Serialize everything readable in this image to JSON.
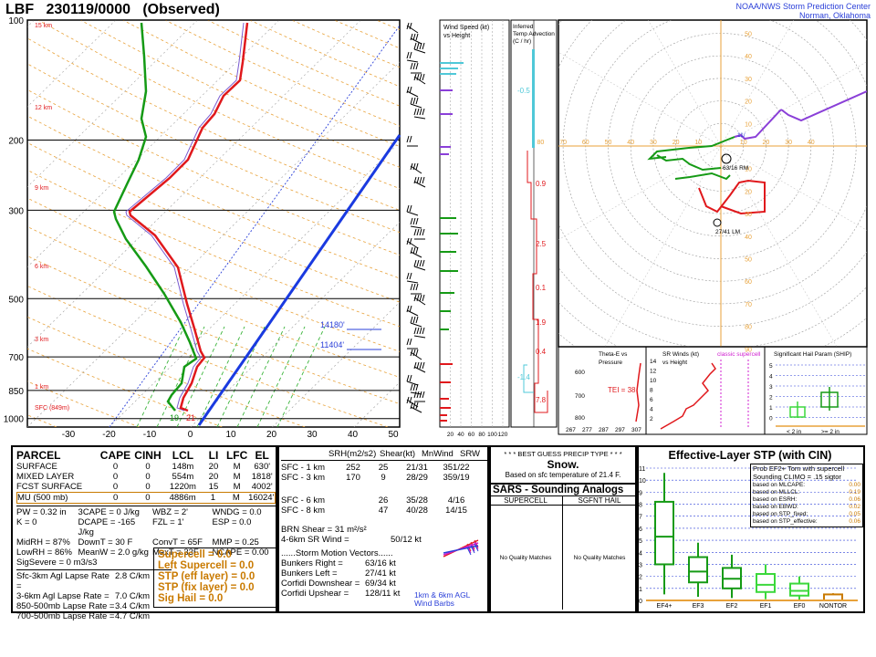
{
  "header": {
    "station": "LBF",
    "time": "230119/0000",
    "status": "(Observed)",
    "spc_line1": "NOAA/NWS Storm Prediction Center",
    "spc_line2": "Norman, Oklahoma"
  },
  "chart_data": [
    {
      "type": "line",
      "title": "Skew-T",
      "pressure_ticks": [
        "100",
        "200",
        "300",
        "500",
        "700",
        "850",
        "1000"
      ],
      "temp_ticks": [
        "-30",
        "-20",
        "-10",
        "0",
        "10",
        "20",
        "30",
        "40",
        "50"
      ],
      "height_labels": [
        "15 km",
        "12 km",
        "9 km",
        "6 km",
        "3 km",
        "1 km",
        "SFC (849m)"
      ],
      "level_labels": [
        "14180'",
        "11404'"
      ],
      "surface_labels": {
        "dew": "19",
        "temp": "21"
      },
      "series": [
        {
          "role": "temperature",
          "color": "#e0181c"
        },
        {
          "role": "dewpoint",
          "color": "#159a15"
        },
        {
          "role": "parcel",
          "color": "#1a3ae0"
        }
      ]
    },
    {
      "type": "line",
      "title": "Wind Speed (kt) vs Height",
      "x_ticks": [
        "20",
        "40",
        "60",
        "80",
        "100",
        "120"
      ]
    },
    {
      "type": "bar",
      "title": "Inferred Temp Advection (C / hr)",
      "values": [
        "-0.5",
        "0.9",
        "2.5",
        "0.1",
        "1.9",
        "0.4",
        "-1.4",
        "7.8"
      ]
    },
    {
      "type": "line",
      "title": "Hodograph",
      "x_ticks": [
        "80",
        "70",
        "60",
        "50",
        "40",
        "30",
        "20",
        "10",
        "10",
        "20",
        "30",
        "40"
      ],
      "y_ticks": [
        "50",
        "40",
        "30",
        "20",
        "10",
        "10",
        "20",
        "30",
        "40",
        "50",
        "60",
        "70",
        "80",
        "90"
      ],
      "labels": {
        "rm": "63/16 RM",
        "lm": "27/41 LM",
        "mean": "11/"
      }
    },
    {
      "type": "line",
      "title": "Theta-E vs Pressure",
      "x_ticks": [
        "267",
        "277",
        "287",
        "297",
        "307"
      ],
      "y_ticks": [
        "600",
        "700",
        "800",
        "900"
      ],
      "tei": "TEI = 38"
    },
    {
      "type": "line",
      "title": "SR Winds (kt) vs Height",
      "y_ticks": [
        "14",
        "12",
        "10",
        "8",
        "6",
        "4",
        "2"
      ],
      "extra": "classic supercell"
    },
    {
      "type": "bar",
      "title": "Significant Hail Param (SHIP)",
      "y_ticks": [
        "5",
        "4",
        "3",
        "2",
        "1",
        "0"
      ],
      "categories": [
        "< 2 in",
        ">= 2 in"
      ]
    },
    {
      "type": "bar",
      "title": "Effective-Layer STP (with CIN)",
      "categories": [
        "EF4+",
        "EF3",
        "EF2",
        "EF1",
        "EF0",
        "NONTOR"
      ],
      "y_ticks": [
        "11",
        "10",
        "9",
        "8",
        "7",
        "6",
        "5",
        "4",
        "3",
        "2",
        "1",
        "0"
      ],
      "medians": [
        5.3,
        2.4,
        1.8,
        1.3,
        0.8,
        0
      ]
    }
  ],
  "parcel_table": {
    "headers": [
      "PARCEL",
      "CAPE",
      "CINH",
      "LCL",
      "LI",
      "LFC",
      "EL"
    ],
    "rows": [
      [
        "SURFACE",
        "0",
        "0",
        "148m",
        "20",
        "M",
        "630'"
      ],
      [
        "MIXED LAYER",
        "0",
        "0",
        "554m",
        "20",
        "M",
        "1818'"
      ],
      [
        "FCST SURFACE",
        "0",
        "0",
        "1220m",
        "15",
        "M",
        "4002'"
      ],
      [
        "MU    (500 mb)",
        "0",
        "0",
        "4886m",
        "1",
        "M",
        "16024'"
      ]
    ],
    "stats": [
      [
        "PW = 0.32 in",
        "3CAPE = 0 J/kg",
        "WBZ = 2'",
        "WNDG = 0.0"
      ],
      [
        "K = 0",
        "DCAPE = -165 J/kg",
        "FZL = 1'",
        "ESP = 0.0"
      ],
      [
        "MidRH = 87%",
        "DownT = 30 F",
        "ConvT = 65F",
        "MMP = 0.25"
      ],
      [
        "LowRH = 86%",
        "MeanW = 2.0 g/kg",
        "MaxT = 33F",
        "NCAPE = 0.00"
      ]
    ],
    "sigsevere": "SigSevere = 0 m3/s3",
    "lapse": [
      [
        "Sfc-3km Agl Lapse Rate =",
        "2.8 C/km"
      ],
      [
        "3-6km Agl Lapse Rate =",
        "7.0 C/km"
      ],
      [
        "850-500mb Lapse Rate =",
        "3.4 C/km"
      ],
      [
        "700-500mb Lapse Rate =",
        "4.7 C/km"
      ]
    ],
    "indices": [
      "Supercell = 0.0",
      "Left Supercell = 0.0",
      "STP (eff layer) = 0.0",
      "STP (fix layer) = 0.0",
      "Sig Hail = 0.0"
    ]
  },
  "kinematics": {
    "headers": [
      "SRH(m2/s2)",
      "Shear(kt)",
      "MnWind",
      "SRW"
    ],
    "rows": [
      [
        "SFC - 1 km",
        "252",
        "25",
        "21/31",
        "351/22"
      ],
      [
        "SFC - 3 km",
        "170",
        "9",
        "28/29",
        "359/19"
      ],
      [
        "SFC - 6 km",
        "",
        "26",
        "35/28",
        "4/16"
      ],
      [
        "SFC - 8 km",
        "",
        "47",
        "40/28",
        "14/15"
      ]
    ],
    "brn_shear": "BRN Shear =  31 m²/s²",
    "sr_wind": "4-6km SR Wind =",
    "sr_wind_val": "50/12 kt",
    "motion_title": "......Storm Motion Vectors......",
    "motion": [
      [
        "Bunkers Right =",
        "63/16 kt"
      ],
      [
        "Bunkers Left =",
        "27/41 kt"
      ],
      [
        "Corfidi Downshear =",
        "69/34 kt"
      ],
      [
        "Corfidi Upshear =",
        "128/11 kt"
      ]
    ],
    "barb_caption1": "1km & 6km AGL",
    "barb_caption2": "Wind Barbs"
  },
  "precip": {
    "title": "* * * BEST GUESS PRECIP TYPE * * *",
    "value": "Snow.",
    "note": "Based on sfc temperature of 21.4 F."
  },
  "sars": {
    "title": "SARS - Sounding Analogs",
    "col1": "SUPERCELL",
    "col2": "SGFNT HAIL",
    "nq1": "No Quality Matches",
    "nq2": "No Quality Matches"
  },
  "stp": {
    "title": "Effective-Layer STP (with CIN)",
    "prob_title1": "Prob EF2+ Torn with supercell",
    "prob_title2": "Sounding CLIMO = .15 sigtor",
    "rows": [
      [
        "based on MLCAPE:",
        "0.00"
      ],
      [
        "based on MLLCL:",
        "0.19"
      ],
      [
        "based on ESRH:",
        "0.06"
      ],
      [
        "based on EBWD:",
        "0.02"
      ],
      [
        "based on STP_fixed:",
        "0.05"
      ],
      [
        "based on STP_effective:",
        "0.06"
      ]
    ]
  },
  "colors": {
    "temp": "#e0181c",
    "dew": "#159a15",
    "parcel": "#1a3ae0",
    "accent": "#c97a00",
    "blue": "#2a3fd8"
  }
}
